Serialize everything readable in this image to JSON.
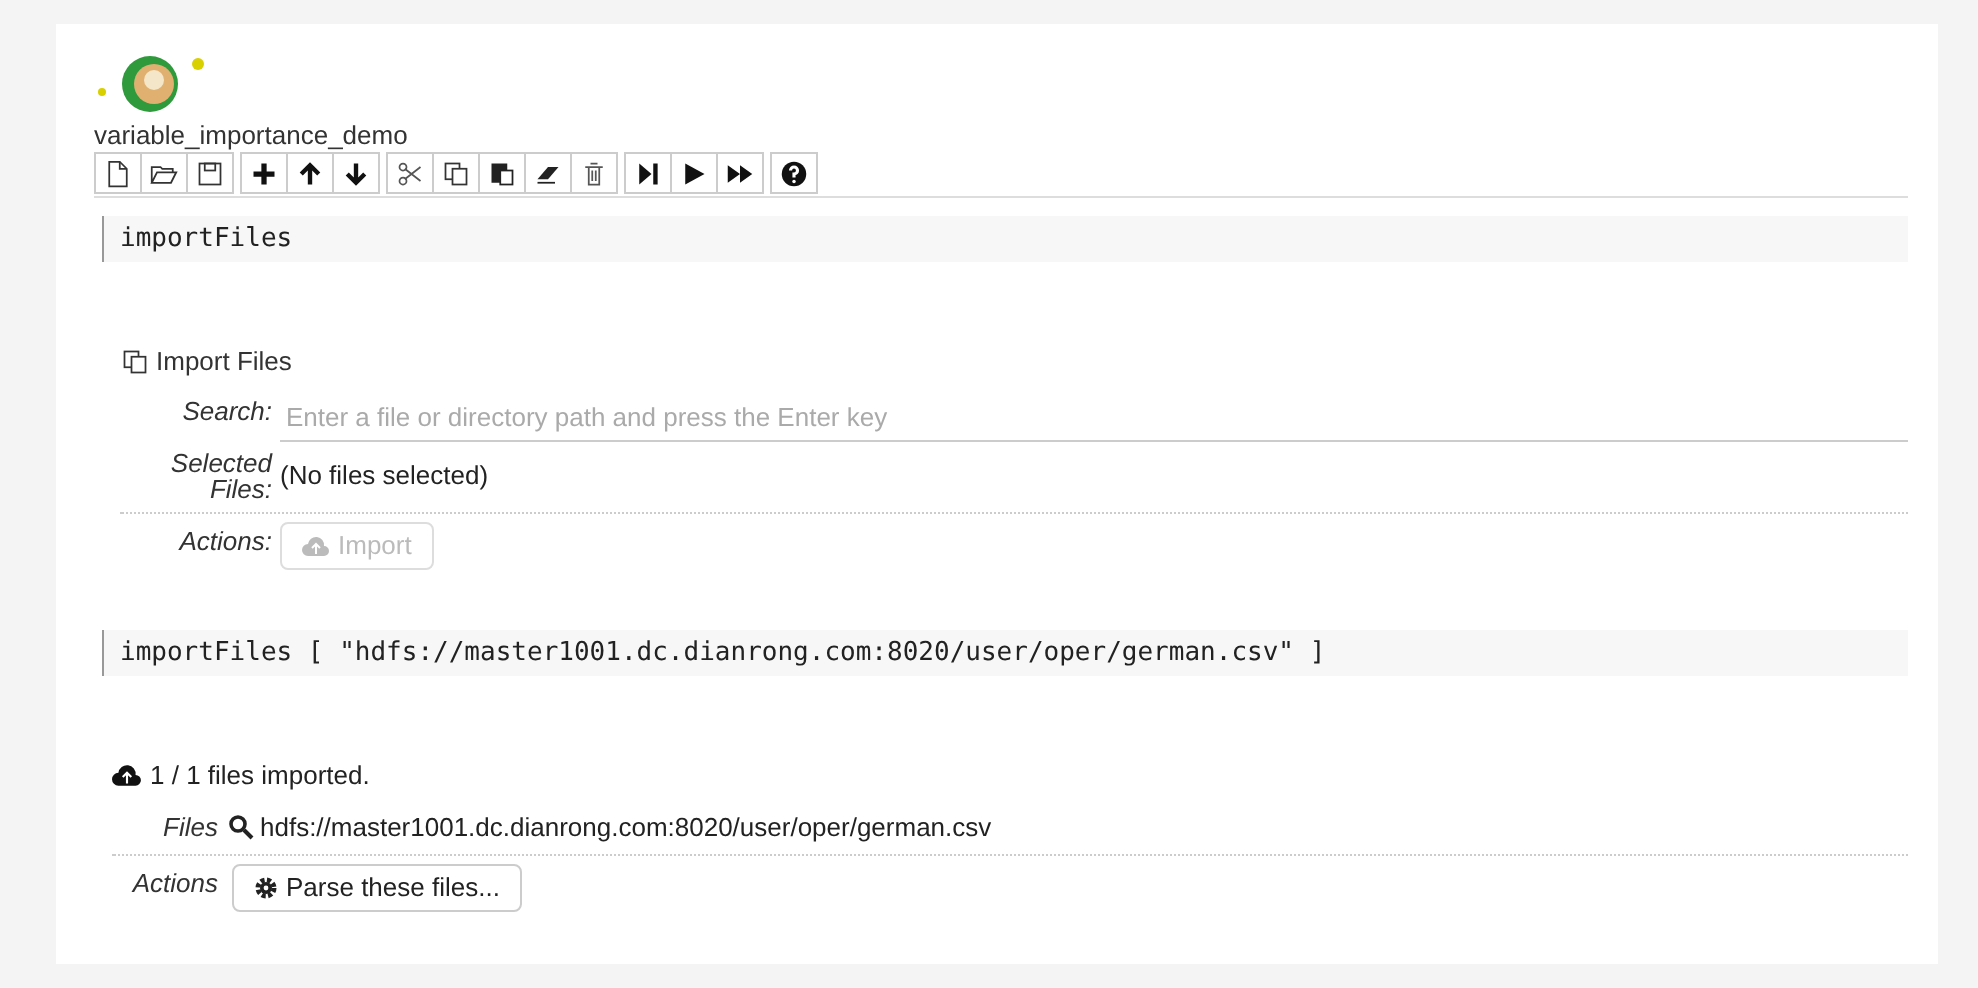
{
  "notebook": {
    "title": "variable_importance_demo"
  },
  "toolbar": [
    [
      {
        "kind": "new"
      },
      {
        "kind": "open"
      },
      {
        "kind": "save"
      }
    ],
    [
      {
        "kind": "add"
      },
      {
        "kind": "up"
      },
      {
        "kind": "down"
      }
    ],
    [
      {
        "kind": "cut"
      },
      {
        "kind": "copy"
      },
      {
        "kind": "paste"
      },
      {
        "kind": "clear"
      },
      {
        "kind": "delete"
      }
    ],
    [
      {
        "kind": "step"
      },
      {
        "kind": "run"
      },
      {
        "kind": "run_all"
      }
    ],
    [
      {
        "kind": "help"
      }
    ]
  ],
  "cells": [
    {
      "kind": "code",
      "code": "importFiles"
    },
    {
      "kind": "import_form",
      "title": "Import Files",
      "search_label": "Search:",
      "search_placeholder": "Enter a file or directory path and press the Enter key",
      "selected_label": [
        "Selected",
        "Files:"
      ],
      "selected_value": "(No files selected)",
      "actions_label": "Actions:",
      "action": {
        "label": "Import",
        "disabled": true
      }
    },
    {
      "kind": "code",
      "code": "importFiles [ \"hdfs://master1001.dc.dianrong.com:8020/user/oper/german.csv\" ]"
    },
    {
      "kind": "import_result",
      "title": "1 / 1 files imported.",
      "files_label": "Files",
      "file": "hdfs://master1001.dc.dianrong.com:8020/user/oper/german.csv",
      "actions_label": "Actions",
      "action": {
        "label": "Parse these files...",
        "disabled": false
      }
    }
  ]
}
